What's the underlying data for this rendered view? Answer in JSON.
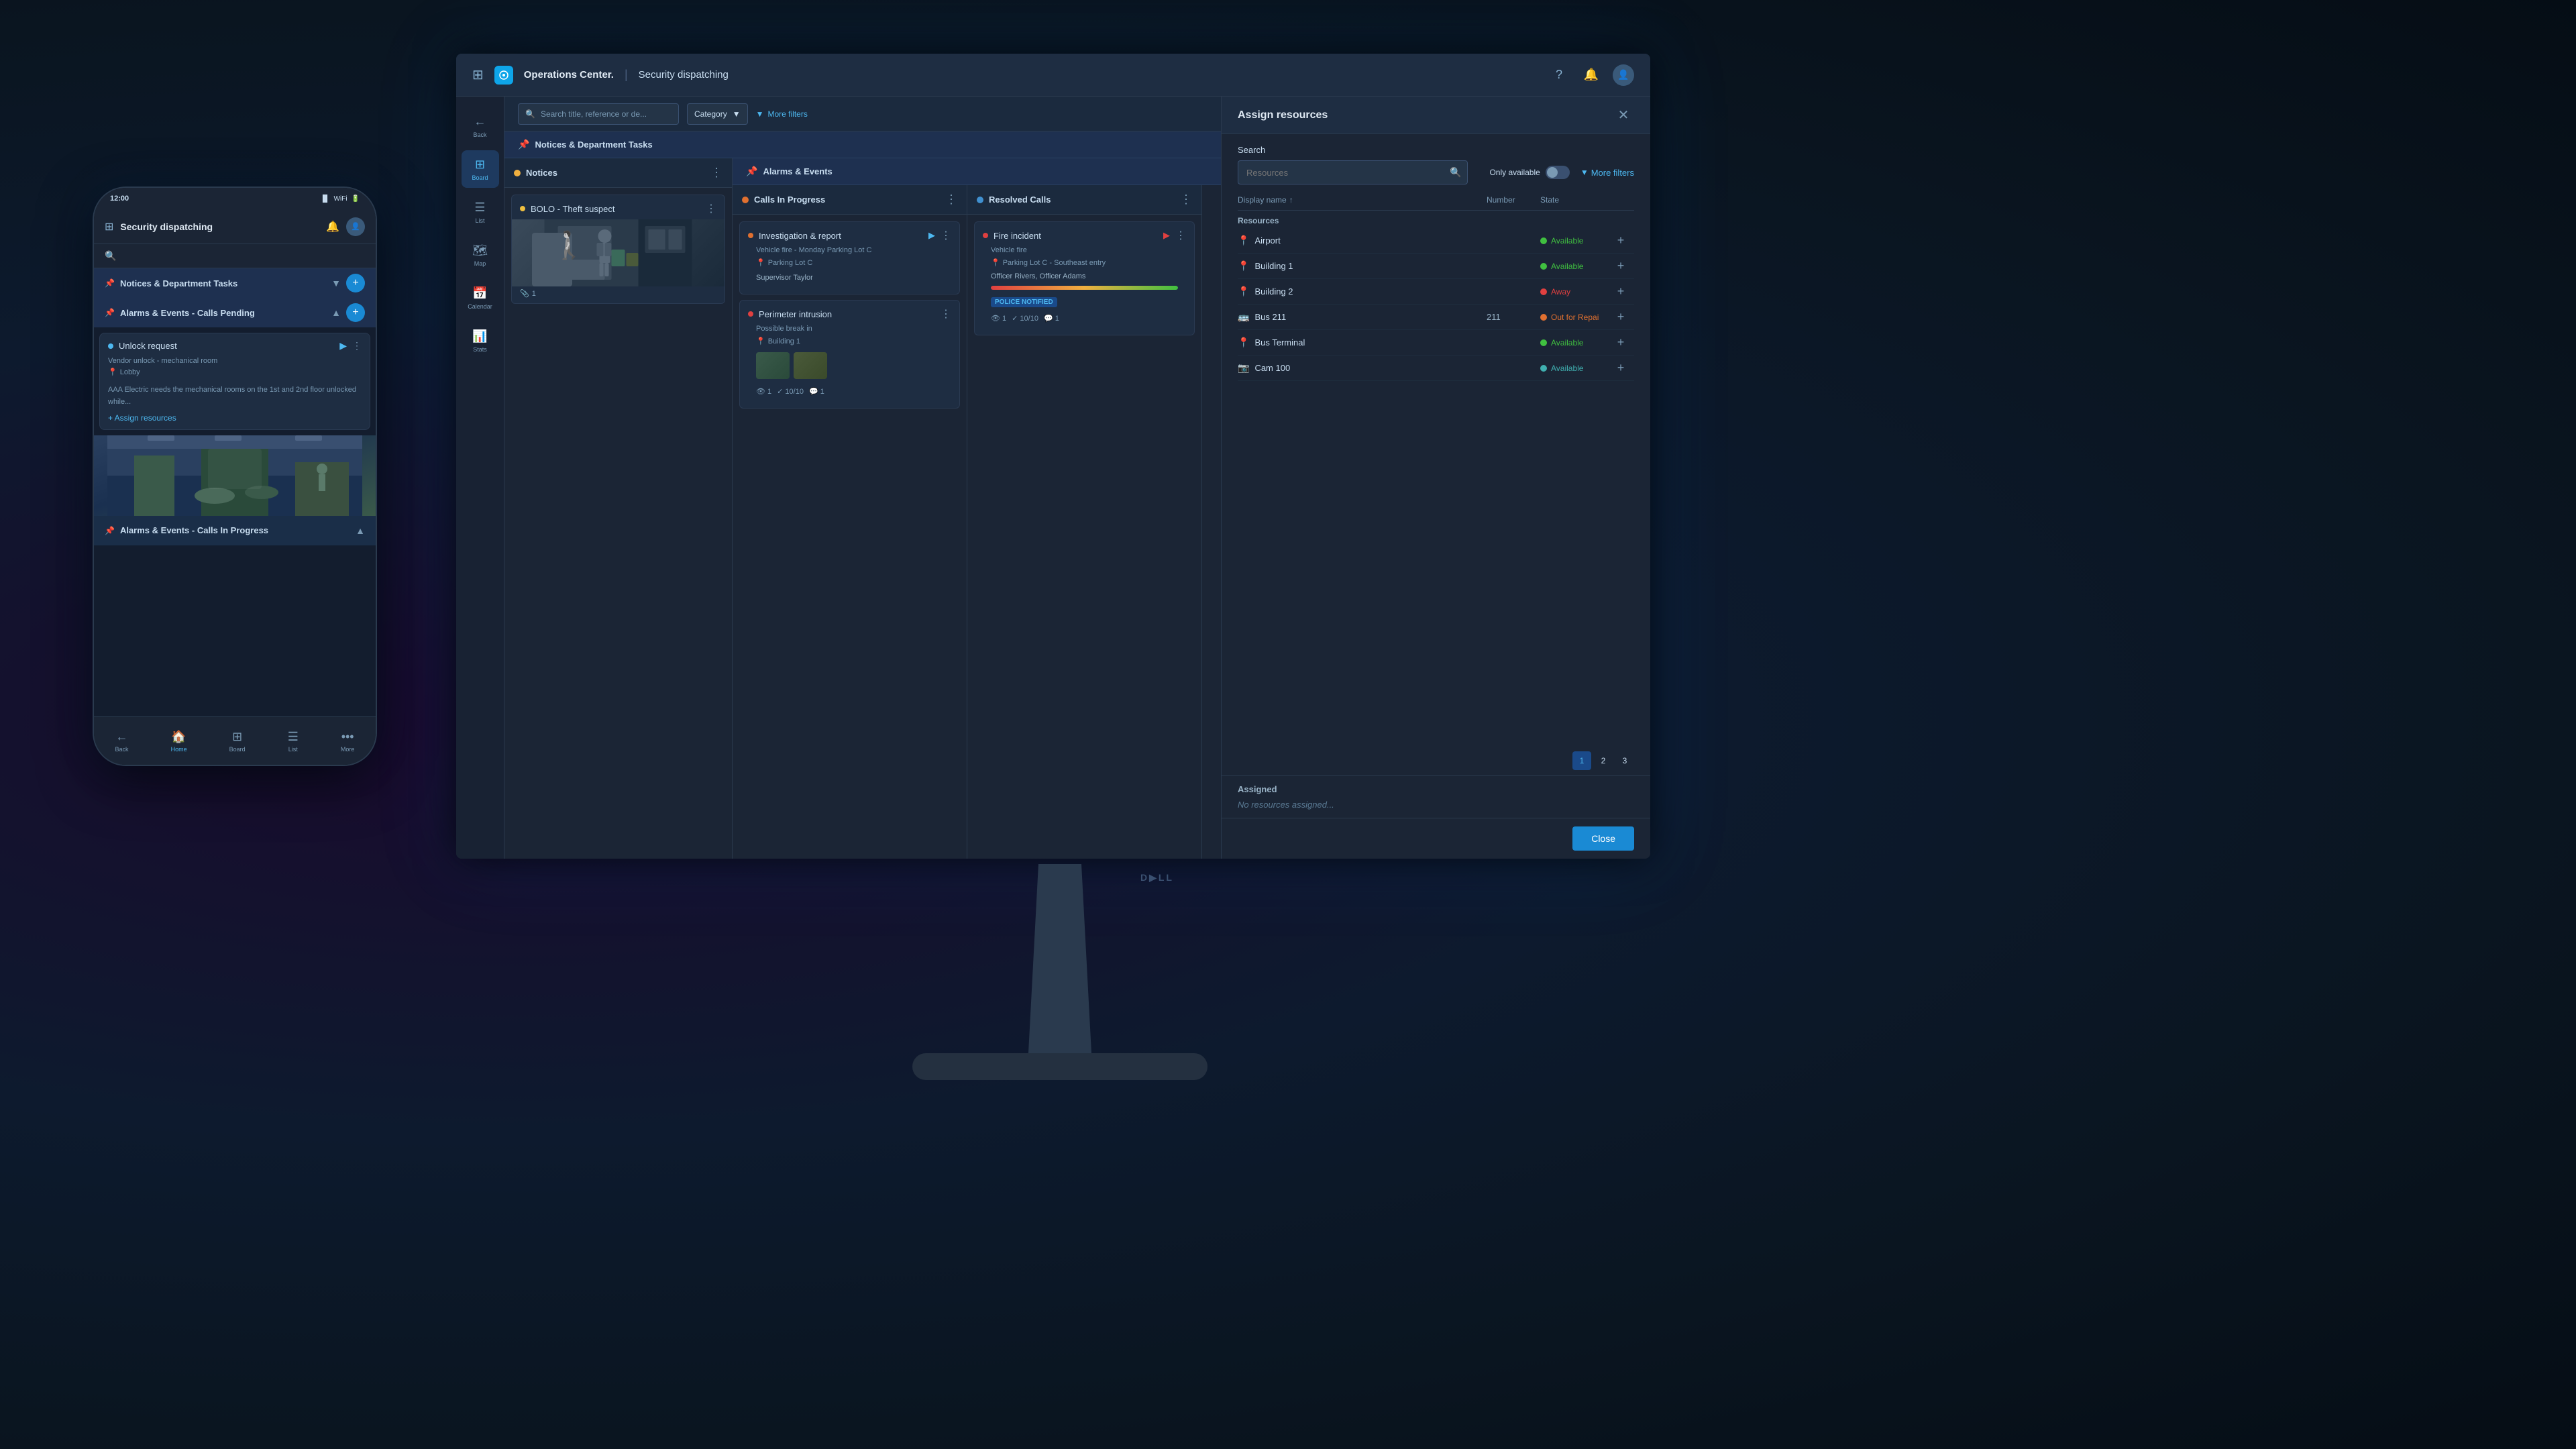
{
  "app": {
    "brand": "Operations Center.",
    "title": "Security dispatching",
    "grid_icon": "⊞",
    "help_icon": "?",
    "bell_icon": "🔔",
    "user_icon": "👤"
  },
  "sidebar": {
    "items": [
      {
        "label": "Back",
        "icon": "←",
        "id": "back"
      },
      {
        "label": "Board",
        "icon": "⊞",
        "id": "board",
        "active": true
      },
      {
        "label": "List",
        "icon": "☰",
        "id": "list"
      },
      {
        "label": "Map",
        "icon": "🗺",
        "id": "map"
      },
      {
        "label": "Calendar",
        "icon": "📅",
        "id": "calendar"
      },
      {
        "label": "Stats",
        "icon": "📊",
        "id": "stats"
      }
    ]
  },
  "filter_bar": {
    "search_placeholder": "Search title, reference or de...",
    "category_label": "Category",
    "more_filters": "More filters"
  },
  "board": {
    "section_pin_icon": "📌",
    "section_title": "Notices & Department Tasks",
    "columns": [
      {
        "id": "notices",
        "dot_color": "yellow",
        "title": "Notices",
        "cards": [
          {
            "id": "bolo-theft",
            "priority_color": "yellow",
            "title": "BOLO - Theft suspect",
            "has_image": true,
            "count": 1
          }
        ]
      },
      {
        "id": "calls-in-progress",
        "dot_color": "orange",
        "title": "Calls In Progress",
        "cards": [
          {
            "id": "investigation",
            "priority_color": "orange",
            "title": "Investigation & report",
            "subtitle": "Vehicle fire - Monday Parking Lot C",
            "location": "Parking Lot C",
            "person": "Supervisor Taylor",
            "progress": 0
          },
          {
            "id": "perimeter",
            "priority_color": "red",
            "title": "Perimeter intrusion",
            "subtitle": "Possible break in",
            "location": "Building 1",
            "has_cameras": true,
            "views": 1,
            "tasks": "10/10",
            "comments": 1
          }
        ]
      },
      {
        "id": "resolved-calls",
        "dot_color": "blue",
        "title": "Resolved Calls",
        "cards": [
          {
            "id": "fire-incident",
            "priority_color": "red",
            "title": "Fire incident",
            "subtitle": "Vehicle fire",
            "location": "Parking Lot C - Southeast entry",
            "persons": "Officer Rivers, Officer Adams",
            "progress": 100,
            "badge": "POLICE NOTIFIED",
            "views": 1,
            "tasks": "10/10",
            "comments": 1
          }
        ]
      }
    ]
  },
  "assign_panel": {
    "title": "Assign resources",
    "search_placeholder": "Resources",
    "only_available_label": "Only available",
    "more_filters": "More filters",
    "columns": {
      "display_name": "Display name",
      "number": "Number",
      "state": "State"
    },
    "resources_label": "Resources",
    "resources": [
      {
        "id": "airport",
        "name": "Airport",
        "icon": "📍",
        "number": "",
        "state": "Available",
        "state_color": "green"
      },
      {
        "id": "building1",
        "name": "Building 1",
        "icon": "📍",
        "number": "",
        "state": "Available",
        "state_color": "green"
      },
      {
        "id": "building2",
        "name": "Building 2",
        "icon": "📍",
        "number": "",
        "state": "Away",
        "state_color": "red"
      },
      {
        "id": "bus211",
        "name": "Bus 211",
        "icon": "🚌",
        "number": "211",
        "state": "Out for Repai",
        "state_color": "orange"
      },
      {
        "id": "busterminal",
        "name": "Bus Terminal",
        "icon": "📍",
        "number": "",
        "state": "Available",
        "state_color": "green"
      },
      {
        "id": "cam100",
        "name": "Cam 100",
        "icon": "📷",
        "number": "",
        "state": "Available",
        "state_color": "teal"
      }
    ],
    "pages": [
      "1",
      "2",
      "3"
    ],
    "assigned_label": "Assigned",
    "no_assigned": "No resources assigned...",
    "close_label": "Close"
  },
  "phone": {
    "app_title": "Security dispatching",
    "section_notices": "Notices & Department Tasks",
    "section_alarms": "Alarms & Events - Calls Pending",
    "section_alarms2": "Alarms & Events - Calls In Progress",
    "card_unlock": {
      "title": "Unlock request",
      "subtitle": "Vendor unlock - mechanical room",
      "location": "Lobby",
      "description": "AAA Electric needs the mechanical rooms on the 1st and 2nd floor unlocked while...",
      "assign_btn": "+ Assign resources"
    },
    "nav": [
      {
        "label": "Back",
        "icon": "←",
        "id": "back"
      },
      {
        "label": "Home",
        "icon": "🏠",
        "id": "home",
        "active": true
      },
      {
        "label": "Board",
        "icon": "⊞",
        "id": "board"
      },
      {
        "label": "List",
        "icon": "☰",
        "id": "list"
      },
      {
        "label": "More",
        "icon": "•••",
        "id": "more"
      }
    ]
  }
}
